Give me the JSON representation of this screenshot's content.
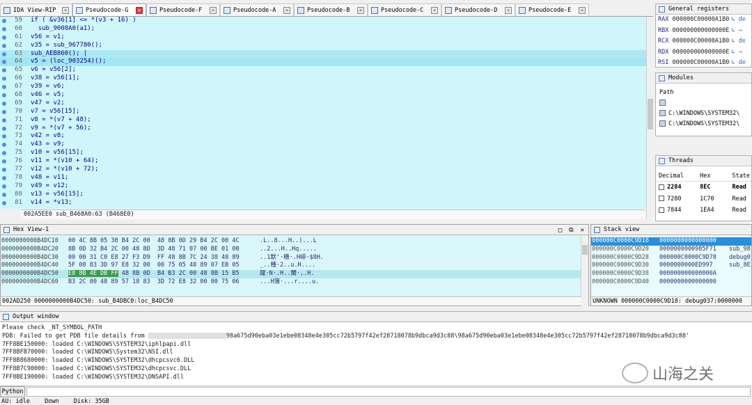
{
  "tabs": [
    {
      "label": "IDA View-RIP",
      "active": false
    },
    {
      "label": "Pseudocode-G",
      "active": true
    },
    {
      "label": "Pseudocode-F",
      "active": false
    },
    {
      "label": "Pseudocode-A",
      "active": false
    },
    {
      "label": "Pseudocode-B",
      "active": false
    },
    {
      "label": "Pseudocode-C",
      "active": false
    },
    {
      "label": "Pseudocode-D",
      "active": false
    },
    {
      "label": "Pseudocode-E",
      "active": false
    }
  ],
  "code": {
    "lines": [
      {
        "num": "59",
        "text": "if ( &v36[1] <= *(v3 + 16) )"
      },
      {
        "num": "60",
        "text": "  sub_9008A0(a1);"
      },
      {
        "num": "61",
        "text": "v56 = v1;"
      },
      {
        "num": "62",
        "text": "v35 = sub_967780();"
      },
      {
        "num": "63",
        "text": "sub_AEB860(); |"
      },
      {
        "num": "64",
        "text": "v5 = (loc_903254)();"
      },
      {
        "num": "65",
        "text": "v6 = v56[2];"
      },
      {
        "num": "66",
        "text": "v38 = v56[1];"
      },
      {
        "num": "67",
        "text": "v39 = v6;"
      },
      {
        "num": "68",
        "text": "v46 = v5;"
      },
      {
        "num": "69",
        "text": "v47 = v2;"
      },
      {
        "num": "70",
        "text": "v7 = v56[15];"
      },
      {
        "num": "71",
        "text": "v8 = *(v7 + 48);"
      },
      {
        "num": "72",
        "text": "v9 = *(v7 + 56);"
      },
      {
        "num": "73",
        "text": "v42 = v8;"
      },
      {
        "num": "74",
        "text": "v43 = v9;"
      },
      {
        "num": "75",
        "text": "v10 = v56[15];"
      },
      {
        "num": "76",
        "text": "v11 = *(v10 + 64);"
      },
      {
        "num": "77",
        "text": "v12 = *(v10 + 72);"
      },
      {
        "num": "78",
        "text": "v48 = v11;"
      },
      {
        "num": "79",
        "text": "v49 = v12;"
      },
      {
        "num": "80",
        "text": "v13 = v56[15];"
      },
      {
        "num": "81",
        "text": "v14 = *v13;"
      }
    ],
    "status": "002A5EE0 sub_B468A0:63 (B468E0)"
  },
  "registers": {
    "title": "General registers",
    "rows": [
      {
        "name": "RAX",
        "value": "000000C00000A1B0",
        "tail": "de"
      },
      {
        "name": "RBX",
        "value": "000000000000000E",
        "tail": "→"
      },
      {
        "name": "RCX",
        "value": "000000C00000A1B0",
        "tail": "de"
      },
      {
        "name": "RDX",
        "value": "000000000000000E",
        "tail": "→"
      },
      {
        "name": "RSI",
        "value": "000000C00000A1B0",
        "tail": "de"
      }
    ]
  },
  "modules": {
    "title": "Modules",
    "header": "Path",
    "rows": [
      "",
      "C:\\WINDOWS\\SYSTEM32\\",
      "C:\\WINDOWS\\SYSTEM32\\"
    ]
  },
  "threads": {
    "title": "Threads",
    "headers": [
      "Decimal",
      "Hex",
      "State"
    ],
    "rows": [
      {
        "dec": "2284",
        "hex": "8EC",
        "state": "Read"
      },
      {
        "dec": "7280",
        "hex": "1C70",
        "state": "Read"
      },
      {
        "dec": "7844",
        "hex": "1EA4",
        "state": "Read"
      }
    ]
  },
  "hex": {
    "title": "Hex View-1",
    "rows": [
      {
        "addr": "0000000000B4DC10",
        "bytes": "00 4C 8B 05 38 B4 2C 00  48 8B 0D 29 B4 2C 00 4C",
        "ascii": ".L..8...H..)...L"
      },
      {
        "addr": "0000000000B4DC20",
        "bytes": "8B 0D 32 B4 2C 00 48 8D  3D 48 71 07 00 BE 01 00",
        "ascii": "..2...H..Hq....."
      },
      {
        "addr": "0000000000B4DC30",
        "bytes": "00 00 31 C0 E8 27 F3 D9  FF 48 8B 7C 24 38 48 89",
        "ascii": "..1默'·穗·.H嵉·$8H."
      },
      {
        "addr": "0000000000B4DC40",
        "bytes": "5F 08 83 3D 97 E8 32 00  00 75 05 48 89 07 EB 05",
        "ascii": "_..種·2..u.H...."
      },
      {
        "addr": "0000000000B4DC50",
        "bytes": "E8 8B 4E DB FF 48 8B 0D  B4 B3 2C 00 48 8B 15 B5",
        "ascii": "躍·N·.H..闈·,.H.",
        "selected": true,
        "selbytes": "E8 8B 4E DB FF"
      },
      {
        "addr": "0000000000B4DC60",
        "bytes": "B3 2C 00 48 89 57 18 83  3D 72 E8 32 00 00 75 06",
        "ascii": "...H簿·...r....u."
      }
    ],
    "status": "002AD250 0000000000B4DC50: sub_B4DBC0:loc_B4DC50"
  },
  "stack": {
    "title": "Stack view",
    "rows": [
      {
        "addr": "000000C0000C9D18",
        "value": "0000000000000000",
        "comment": "",
        "selected": true
      },
      {
        "addr": "000000C0000C9D20",
        "value": "0000000000985F71",
        "comment": "sub_98"
      },
      {
        "addr": "000000C0000C9D28",
        "value": "000000C0000C9D78",
        "comment": "debug0"
      },
      {
        "addr": "000000C0000C9D30",
        "value": "0000000000ED997",
        "comment": "sub_8E"
      },
      {
        "addr": "000000C0000C9D38",
        "value": "000000000000000A",
        "comment": ""
      },
      {
        "addr": "000000C0000C9D40",
        "value": "0000000000000000",
        "comment": ""
      }
    ],
    "status": "UNKNOWN 000000C0000C9D18: debug037:0000000"
  },
  "output": {
    "title": "Output window",
    "lines": [
      {
        "pre": "Please check _NT_SYMBOL_PATH",
        "post": ""
      },
      {
        "pre": "PDB: Failed to get PDB file details from ",
        "post": "98a675d90eba03e1ebe08348e4e305cc72b5797f42ef28718078b9dbca9d3c88\\98a675d90eba03e1ebe08348e4e305cc72b5797f42ef28718078b9dbca9d3c88'",
        "redacted": true
      },
      {
        "pre": "7FF8BE150000: loaded C:\\WINDOWS\\SYSTEM32\\iphlpapi.dll",
        "post": ""
      },
      {
        "pre": "7FF8BFB70000: loaded C:\\WINDOWS\\System32\\NSI.dll",
        "post": ""
      },
      {
        "pre": "7FF8B8680000: loaded C:\\WINDOWS\\SYSTEM32\\dhcpcsvc6.DLL",
        "post": ""
      },
      {
        "pre": "7FF8B7C90000: loaded C:\\WINDOWS\\SYSTEM32\\dhcpcsvc.DLL",
        "post": ""
      },
      {
        "pre": "7FF8BE190000: loaded C:\\WINDOWS\\SYSTEM32\\DNSAPI.dll",
        "post": ""
      }
    ]
  },
  "watermark": {
    "text": "山海之关"
  },
  "python": {
    "label": "Python"
  },
  "statusbar": {
    "au": "AU:  idle",
    "dir": "Down",
    "disk": "Disk: 35GB"
  }
}
